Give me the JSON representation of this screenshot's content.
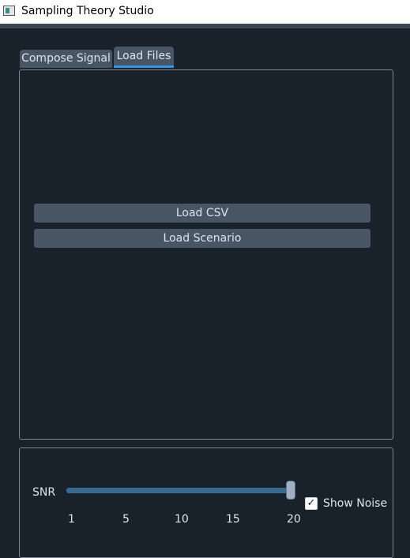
{
  "window": {
    "title": "Sampling Theory Studio"
  },
  "tabs": [
    {
      "label": "Compose Signal",
      "active": false
    },
    {
      "label": "Load Files",
      "active": true
    }
  ],
  "load_panel": {
    "load_csv_label": "Load CSV",
    "load_scenario_label": "Load Scenario"
  },
  "noise": {
    "snr_label": "SNR",
    "snr_value": 20,
    "snr_min": 1,
    "snr_max": 20,
    "ticks": [
      "1",
      "5",
      "10",
      "15",
      "20"
    ],
    "show_noise_label": "Show Noise",
    "show_noise_checked": true,
    "check_mark": "✓"
  },
  "colors": {
    "background": "#19212b",
    "tab_active_underline": "#3593e0",
    "button": "#475565",
    "slider_track": "#3a6a94"
  },
  "icons": {
    "app": "app-window-icon",
    "checkbox": "check-icon"
  }
}
